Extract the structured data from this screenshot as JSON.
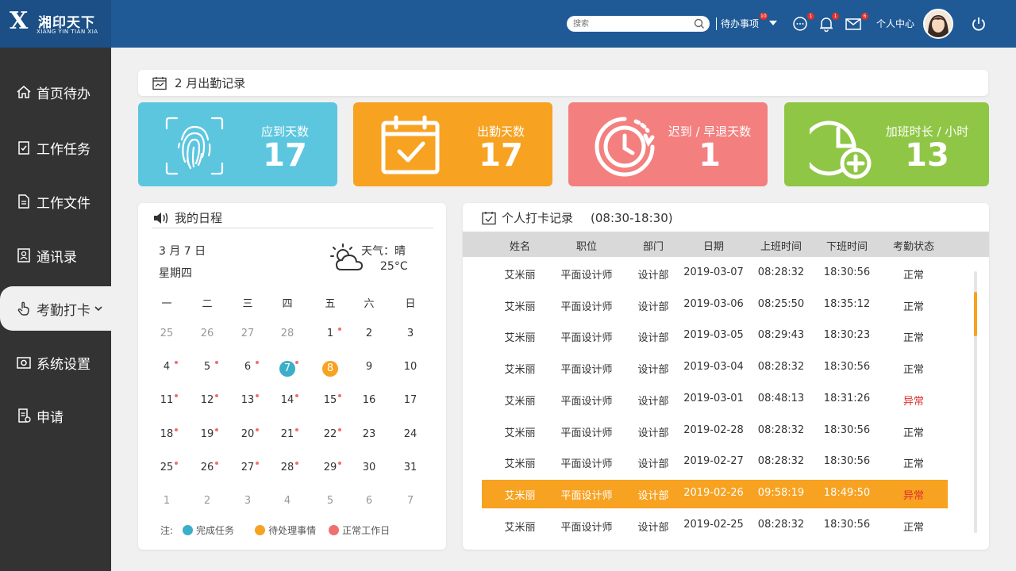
{
  "header": {
    "logo_letter": "X",
    "logo_name": "湘印天下",
    "logo_sub": "XIANG YIN TIAN XIA",
    "search_placeholder": "搜索",
    "todo_label": "待办事项",
    "todo_badge": "10",
    "chat_badge": "1",
    "bell_badge": "1",
    "mail_badge": "6",
    "profile_label": "个人中心"
  },
  "sidebar": {
    "items": [
      {
        "label": "首页待办",
        "icon": "home-icon"
      },
      {
        "label": "工作任务",
        "icon": "task-icon"
      },
      {
        "label": "工作文件",
        "icon": "file-icon"
      },
      {
        "label": "通讯录",
        "icon": "contacts-icon"
      },
      {
        "label": "考勤打卡",
        "icon": "hand-icon"
      },
      {
        "label": "系统设置",
        "icon": "settings-icon"
      },
      {
        "label": "申请",
        "icon": "apply-icon"
      }
    ],
    "active_index": 4
  },
  "attendance": {
    "title": "2 月出勤记录",
    "cards": [
      {
        "label": "应到天数",
        "value": "17",
        "color": "#5cc6df",
        "icon": "fingerprint-icon"
      },
      {
        "label": "出勤天数",
        "value": "17",
        "color": "#f7a221",
        "icon": "calendar-check-icon"
      },
      {
        "label": "迟到 / 早退天数",
        "value": "1",
        "color": "#f47f7f",
        "icon": "clock-icon"
      },
      {
        "label": "加班时长 / 小时",
        "value": "13",
        "color": "#8fc645",
        "icon": "clock-plus-icon"
      }
    ]
  },
  "schedule": {
    "title": "我的日程",
    "date": "3 月 7 日",
    "weekday": "星期四",
    "weather_label": "天气：晴",
    "temperature": "25°C",
    "weekdays": [
      "一",
      "二",
      "三",
      "四",
      "五",
      "六",
      "日"
    ],
    "weeks": [
      [
        [
          "25",
          0,
          0
        ],
        [
          "26",
          0,
          0
        ],
        [
          "27",
          0,
          0
        ],
        [
          "28",
          0,
          0
        ],
        [
          "1",
          1,
          1
        ],
        [
          "2",
          1,
          0
        ],
        [
          "3",
          1,
          0
        ]
      ],
      [
        [
          "4",
          1,
          1
        ],
        [
          "5",
          1,
          1
        ],
        [
          "6",
          1,
          1
        ],
        [
          "7",
          1,
          1
        ],
        [
          "8",
          1,
          0
        ],
        [
          "9",
          1,
          0
        ],
        [
          "10",
          1,
          0
        ]
      ],
      [
        [
          "11",
          1,
          1
        ],
        [
          "12",
          1,
          1
        ],
        [
          "13",
          1,
          1
        ],
        [
          "14",
          1,
          1
        ],
        [
          "15",
          1,
          1
        ],
        [
          "16",
          1,
          0
        ],
        [
          "17",
          1,
          0
        ]
      ],
      [
        [
          "18",
          1,
          1
        ],
        [
          "19",
          1,
          1
        ],
        [
          "20",
          1,
          1
        ],
        [
          "21",
          1,
          1
        ],
        [
          "22",
          1,
          1
        ],
        [
          "23",
          1,
          0
        ],
        [
          "24",
          1,
          0
        ]
      ],
      [
        [
          "25",
          1,
          1
        ],
        [
          "26",
          1,
          1
        ],
        [
          "27",
          1,
          1
        ],
        [
          "28",
          1,
          1
        ],
        [
          "29",
          1,
          1
        ],
        [
          "30",
          1,
          0
        ],
        [
          "31",
          1,
          0
        ]
      ],
      [
        [
          "1",
          0,
          0
        ],
        [
          "2",
          0,
          0
        ],
        [
          "3",
          0,
          0
        ],
        [
          "4",
          0,
          0
        ],
        [
          "5",
          0,
          0
        ],
        [
          "6",
          0,
          0
        ],
        [
          "7",
          0,
          0
        ]
      ]
    ],
    "completed_day": "7",
    "pending_day": "8",
    "legend_prefix": "注:",
    "legend": [
      {
        "label": "完成任务",
        "color": "#3aafc7"
      },
      {
        "label": "待处理事情",
        "color": "#f7a221"
      },
      {
        "label": "正常工作日",
        "color": "#f06f6f"
      }
    ]
  },
  "punch": {
    "title": "个人打卡记录",
    "range": "(08:30-18:30)",
    "columns": [
      "姓名",
      "职位",
      "部门",
      "日期",
      "上班时间",
      "下班时间",
      "考勤状态"
    ],
    "rows": [
      [
        "艾米丽",
        "平面设计师",
        "设计部",
        "2019-03-07",
        "08:28:32",
        "18:30:56",
        "正常"
      ],
      [
        "艾米丽",
        "平面设计师",
        "设计部",
        "2019-03-06",
        "08:25:50",
        "18:35:12",
        "正常"
      ],
      [
        "艾米丽",
        "平面设计师",
        "设计部",
        "2019-03-05",
        "08:29:43",
        "18:30:23",
        "正常"
      ],
      [
        "艾米丽",
        "平面设计师",
        "设计部",
        "2019-03-04",
        "08:28:32",
        "18:30:56",
        "正常"
      ],
      [
        "艾米丽",
        "平面设计师",
        "设计部",
        "2019-03-01",
        "08:48:13",
        "18:31:26",
        "异常"
      ],
      [
        "艾米丽",
        "平面设计师",
        "设计部",
        "2019-02-28",
        "08:28:32",
        "18:30:56",
        "正常"
      ],
      [
        "艾米丽",
        "平面设计师",
        "设计部",
        "2019-02-27",
        "08:28:32",
        "18:30:56",
        "正常"
      ],
      [
        "艾米丽",
        "平面设计师",
        "设计部",
        "2019-02-26",
        "09:58:19",
        "18:49:50",
        "异常"
      ],
      [
        "艾米丽",
        "平面设计师",
        "设计部",
        "2019-02-25",
        "08:28:32",
        "18:30:56",
        "正常"
      ]
    ],
    "highlight_row": 7,
    "abnormal_label": "异常"
  }
}
